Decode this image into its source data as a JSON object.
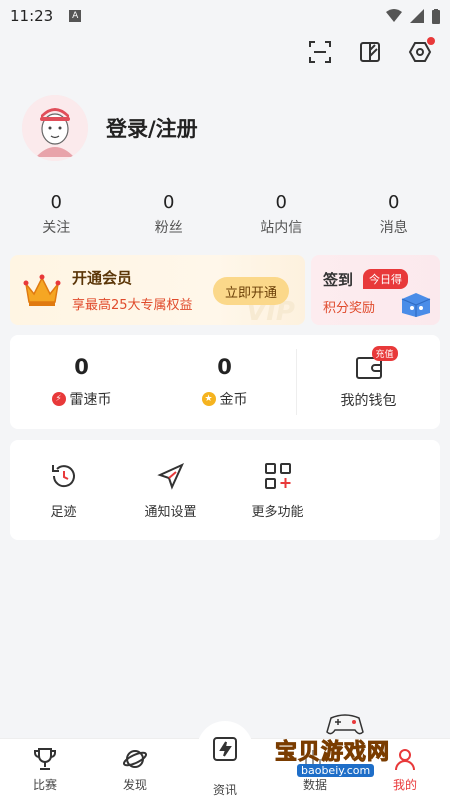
{
  "status_bar": {
    "time": "11:23",
    "a_badge": "A"
  },
  "top_icons": [
    "scan-icon",
    "theme-icon",
    "settings-icon"
  ],
  "profile": {
    "login_label": "登录/注册"
  },
  "stats": [
    {
      "value": "0",
      "label": "关注"
    },
    {
      "value": "0",
      "label": "粉丝"
    },
    {
      "value": "0",
      "label": "站内信"
    },
    {
      "value": "0",
      "label": "消息"
    }
  ],
  "vip": {
    "title": "开通会员",
    "subtitle": "享最高25大专属权益",
    "button": "立即开通",
    "watermark": "VIP"
  },
  "sign_in": {
    "title": "签到",
    "badge": "今日得",
    "subtitle": "积分奖励"
  },
  "wallet": {
    "lei_coin": {
      "value": "0",
      "label": "雷速币"
    },
    "gold_coin": {
      "value": "0",
      "label": "金币"
    },
    "purse": {
      "label": "我的钱包",
      "badge": "充值"
    }
  },
  "functions": [
    {
      "label": "足迹",
      "icon": "history-icon"
    },
    {
      "label": "通知设置",
      "icon": "send-icon"
    },
    {
      "label": "更多功能",
      "icon": "grid-plus-icon"
    }
  ],
  "tabs": [
    {
      "label": "比赛",
      "icon": "trophy-icon"
    },
    {
      "label": "发现",
      "icon": "planet-icon"
    },
    {
      "label": "资讯",
      "icon": "news-bolt-icon"
    },
    {
      "label": "数据",
      "icon": "data-icon"
    },
    {
      "label": "我的",
      "icon": "profile-icon",
      "active": true
    }
  ],
  "watermark": {
    "title": "宝贝游戏网",
    "url": "baobeiy.com"
  },
  "colors": {
    "accent": "#e8393a",
    "vip_text": "#5b3608",
    "vip_button": "#fbd88a",
    "background": "#f4f5f7"
  }
}
